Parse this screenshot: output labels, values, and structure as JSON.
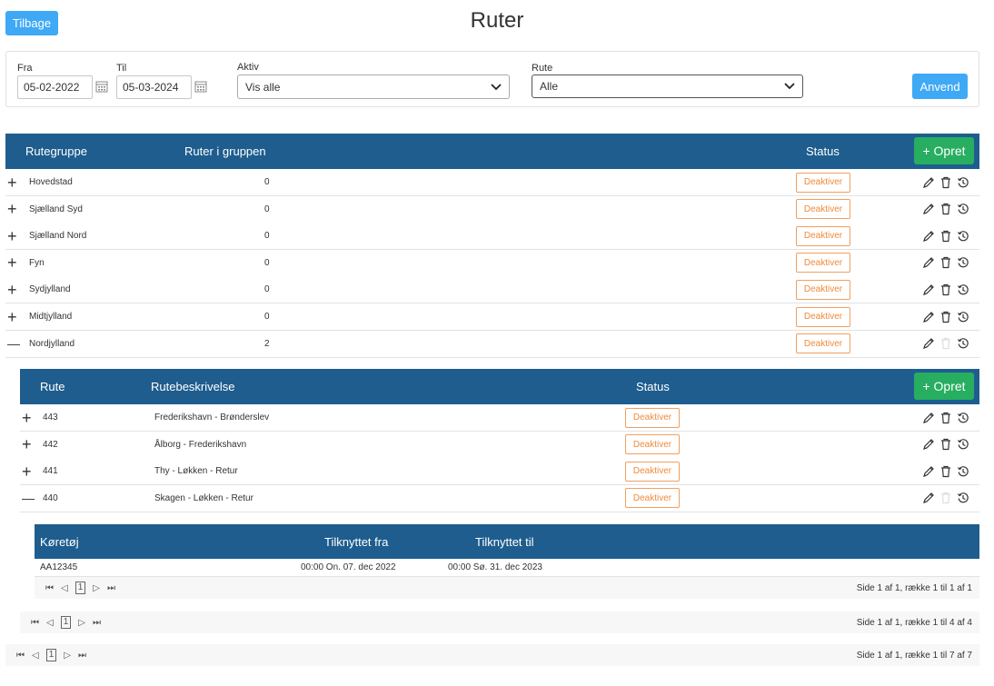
{
  "header": {
    "back_label": "Tilbage",
    "title": "Ruter"
  },
  "filters": {
    "from_label": "Fra",
    "from_value": "05-02-2022",
    "to_label": "Til",
    "to_value": "05-03-2024",
    "active_label": "Aktiv",
    "active_value": "Vis alle",
    "route_label": "Rute",
    "route_value": "Alle",
    "apply_label": "Anvend"
  },
  "groups": {
    "headers": {
      "group": "Rutegruppe",
      "count": "Ruter i gruppen",
      "status": "Status"
    },
    "create_label": "+ Opret",
    "rows": [
      {
        "name": "Hovedstad",
        "count": "0",
        "status": "Deaktiver",
        "expanded": false
      },
      {
        "name": "Sjælland Syd",
        "count": "0",
        "status": "Deaktiver",
        "expanded": false
      },
      {
        "name": "Sjælland Nord",
        "count": "0",
        "status": "Deaktiver",
        "expanded": false
      },
      {
        "name": "Fyn",
        "count": "0",
        "status": "Deaktiver",
        "expanded": false
      },
      {
        "name": "Sydjylland",
        "count": "0",
        "status": "Deaktiver",
        "expanded": false
      },
      {
        "name": "Midtjylland",
        "count": "0",
        "status": "Deaktiver",
        "expanded": false
      },
      {
        "name": "Nordjylland",
        "count": "2",
        "status": "Deaktiver",
        "expanded": true
      }
    ],
    "pager": {
      "page": "1",
      "info": "Side 1 af 1, række 1 til 7 af 7"
    }
  },
  "routes": {
    "headers": {
      "route": "Rute",
      "desc": "Rutebeskrivelse",
      "status": "Status"
    },
    "create_label": "+ Opret",
    "rows": [
      {
        "route": "443",
        "desc": "Frederikshavn - Brønderslev",
        "status": "Deaktiver",
        "expanded": false
      },
      {
        "route": "442",
        "desc": "Ålborg - Frederikshavn",
        "status": "Deaktiver",
        "expanded": false
      },
      {
        "route": "441",
        "desc": "Thy - Løkken - Retur",
        "status": "Deaktiver",
        "expanded": false
      },
      {
        "route": "440",
        "desc": "Skagen - Løkken - Retur",
        "status": "Deaktiver",
        "expanded": true
      }
    ],
    "pager": {
      "page": "1",
      "info": "Side 1 af 1, række 1 til 4 af 4"
    }
  },
  "vehicles": {
    "headers": {
      "vehicle": "Køretøj",
      "from": "Tilknyttet fra",
      "to": "Tilknyttet til"
    },
    "rows": [
      {
        "vehicle": "AA12345",
        "from": "00:00 On. 07. dec 2022",
        "to": "00:00 Sø. 31. dec 2023"
      }
    ],
    "pager": {
      "page": "1",
      "info": "Side 1 af 1, række 1 til 1 af 1"
    }
  },
  "colors": {
    "header_bg": "#1e5d8e",
    "primary": "#3fa9f5",
    "create": "#27ae60",
    "deactivate": "#f08a3a",
    "expand": "#3aa34a",
    "collapse": "#e74c3c"
  }
}
